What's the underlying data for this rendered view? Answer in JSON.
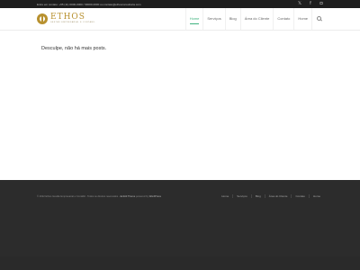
{
  "topbar": {
    "contact": "Entre em contato: +55 (11) 0000-0000 / 99000-0000 ou contato@ethosconsultoria.com",
    "social": [
      {
        "icon": "twitter-icon",
        "glyph": "𝕏"
      },
      {
        "icon": "facebook-icon",
        "glyph": "f"
      },
      {
        "icon": "instagram-icon",
        "glyph": "◘"
      }
    ]
  },
  "header": {
    "logo_title": "ETHOS",
    "logo_subtitle": "GESTÃO EMPRESARIAL E CONTÁBIL",
    "nav": [
      {
        "label": "Home",
        "active": true
      },
      {
        "label": "Serviços",
        "active": false
      },
      {
        "label": "Blog",
        "active": false
      },
      {
        "label": "Área do Cliente",
        "active": false
      },
      {
        "label": "Contato",
        "active": false
      },
      {
        "label": "Home",
        "active": false
      }
    ],
    "accent_color": "#3fb27f"
  },
  "main": {
    "message": "Desculpe, não há mais posts."
  },
  "footer": {
    "copyright": "© 2022 Ethos Gestão Empresarial e Contábil - Todos os direitos reservados - ",
    "theme_link": "Enfold Theme",
    "wp_prefix": " powered by ",
    "wp_link": "WordPress",
    "nav": [
      "Home",
      "Serviços",
      "Blog",
      "Área do Cliente",
      "Contato",
      "Home"
    ]
  }
}
